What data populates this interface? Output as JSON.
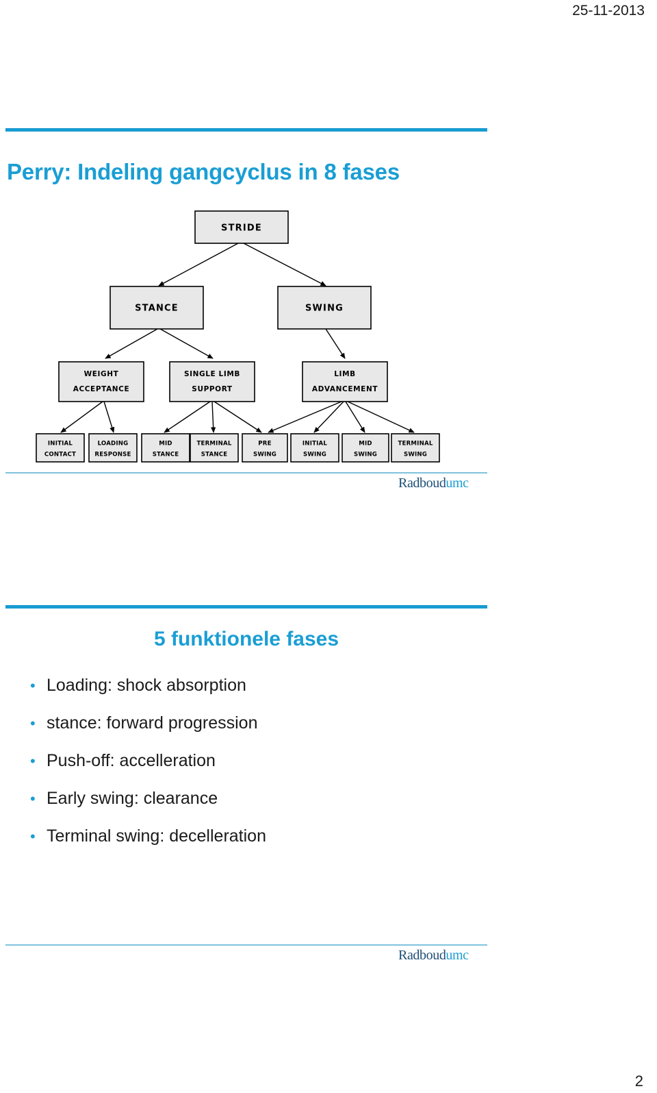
{
  "header": {
    "date": "25-11-2013"
  },
  "footer": {
    "page_number": "2"
  },
  "brand": {
    "logo_main": "Radboud",
    "logo_sub": "umc",
    "accent_color": "#189cd2",
    "logo_main_color": "#1d4f76",
    "logo_sub_color": "#1a9ed4"
  },
  "slide1": {
    "title": "Perry: Indeling gangcyclus in 8 fases",
    "diagram": {
      "level1": [
        {
          "label": "STRIDE"
        }
      ],
      "level2": [
        {
          "label": "STANCE"
        },
        {
          "label": "SWING"
        }
      ],
      "level3": [
        {
          "line1": "WEIGHT",
          "line2": "ACCEPTANCE"
        },
        {
          "line1": "SINGLE LIMB",
          "line2": "SUPPORT"
        },
        {
          "line1": "LIMB",
          "line2": "ADVANCEMENT"
        }
      ],
      "level4": [
        {
          "line1": "INITIAL",
          "line2": "CONTACT"
        },
        {
          "line1": "LOADING",
          "line2": "RESPONSE"
        },
        {
          "line1": "MID",
          "line2": "STANCE"
        },
        {
          "line1": "TERMINAL",
          "line2": "STANCE"
        },
        {
          "line1": "PRE",
          "line2": "SWING"
        },
        {
          "line1": "INITIAL",
          "line2": "SWING"
        },
        {
          "line1": "MID",
          "line2": "SWING"
        },
        {
          "line1": "TERMINAL",
          "line2": "SWING"
        }
      ]
    }
  },
  "slide2": {
    "title": "5 funktionele fases",
    "bullet_marker": "•",
    "bullets": [
      {
        "text": "Loading: shock absorption"
      },
      {
        "text": "stance:  forward progression"
      },
      {
        "text": "Push-off: accelleration"
      },
      {
        "text": "Early swing: clearance"
      },
      {
        "text": "Terminal swing: decelleration"
      }
    ]
  }
}
